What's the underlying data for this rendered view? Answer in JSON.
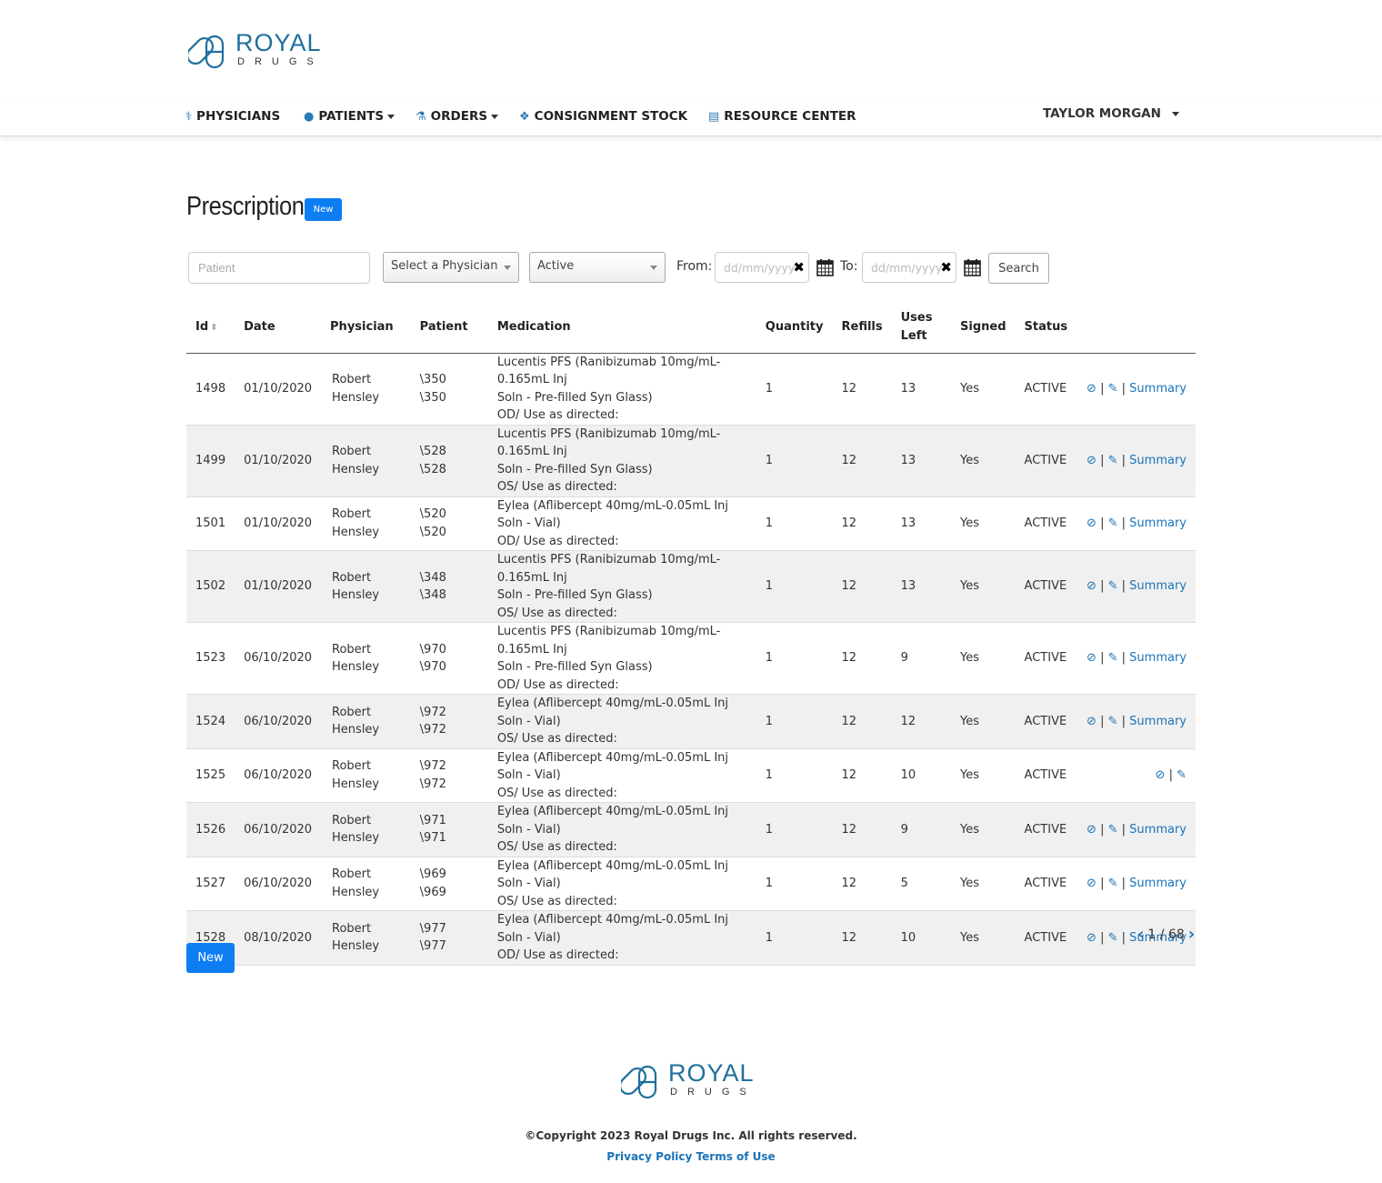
{
  "brand": {
    "name_top": "ROYAL",
    "name_bottom": "DRUGS"
  },
  "nav": {
    "physicians": "PHYSICIANS",
    "patients": "PATIENTS",
    "orders": "ORDERS",
    "consignment": "CONSIGNMENT STOCK",
    "resources": "RESOURCE CENTER",
    "user": "TAYLOR MORGAN"
  },
  "page": {
    "title": "Prescriptions",
    "new_badge": "New",
    "new_button": "New"
  },
  "filters": {
    "patient_placeholder": "Patient",
    "physician_select": "Select a Physician",
    "status_select": "Active",
    "from_label": "From:",
    "to_label": "To:",
    "date_placeholder": "dd/mm/yyyy",
    "search_label": "Search"
  },
  "table": {
    "headers": [
      "Id",
      "Date",
      "Physician",
      "Patient",
      "Medication",
      "Quantity",
      "Refills",
      "Uses Left",
      "Signed",
      "Status"
    ],
    "summary_label": "Summary",
    "rows": [
      {
        "id": "1498",
        "date": "01/10/2020",
        "physician": [
          "Robert",
          "Hensley"
        ],
        "patient": [
          "\\350",
          "\\350"
        ],
        "medication": [
          "Lucentis PFS (Ranibizumab 10mg/mL-0.165mL Inj",
          "Soln - Pre-filled Syn Glass)",
          "OD/ Use as directed:"
        ],
        "quantity": "1",
        "refills": "12",
        "uses_left": "13",
        "signed": "Yes",
        "status": "ACTIVE",
        "summary": true
      },
      {
        "id": "1499",
        "date": "01/10/2020",
        "physician": [
          "Robert",
          "Hensley"
        ],
        "patient": [
          "\\528",
          "\\528"
        ],
        "medication": [
          "Lucentis PFS (Ranibizumab 10mg/mL-0.165mL Inj",
          "Soln - Pre-filled Syn Glass)",
          "OS/ Use as directed:"
        ],
        "quantity": "1",
        "refills": "12",
        "uses_left": "13",
        "signed": "Yes",
        "status": "ACTIVE",
        "summary": true
      },
      {
        "id": "1501",
        "date": "01/10/2020",
        "physician": [
          "Robert",
          "Hensley"
        ],
        "patient": [
          "\\520",
          "\\520"
        ],
        "medication": [
          "Eylea (Aflibercept 40mg/mL-0.05mL Inj Soln - Vial)",
          "OD/ Use as directed:"
        ],
        "quantity": "1",
        "refills": "12",
        "uses_left": "13",
        "signed": "Yes",
        "status": "ACTIVE",
        "summary": true
      },
      {
        "id": "1502",
        "date": "01/10/2020",
        "physician": [
          "Robert",
          "Hensley"
        ],
        "patient": [
          "\\348",
          "\\348"
        ],
        "medication": [
          "Lucentis PFS (Ranibizumab 10mg/mL-0.165mL Inj",
          "Soln - Pre-filled Syn Glass)",
          "OS/ Use as directed:"
        ],
        "quantity": "1",
        "refills": "12",
        "uses_left": "13",
        "signed": "Yes",
        "status": "ACTIVE",
        "summary": true
      },
      {
        "id": "1523",
        "date": "06/10/2020",
        "physician": [
          "Robert",
          "Hensley"
        ],
        "patient": [
          "\\970",
          "\\970"
        ],
        "medication": [
          "Lucentis PFS (Ranibizumab 10mg/mL-0.165mL Inj",
          "Soln - Pre-filled Syn Glass)",
          "OD/ Use as directed:"
        ],
        "quantity": "1",
        "refills": "12",
        "uses_left": "9",
        "signed": "Yes",
        "status": "ACTIVE",
        "summary": true
      },
      {
        "id": "1524",
        "date": "06/10/2020",
        "physician": [
          "Robert",
          "Hensley"
        ],
        "patient": [
          "\\972",
          "\\972"
        ],
        "medication": [
          "Eylea (Aflibercept 40mg/mL-0.05mL Inj Soln - Vial)",
          "OS/ Use as directed:"
        ],
        "quantity": "1",
        "refills": "12",
        "uses_left": "12",
        "signed": "Yes",
        "status": "ACTIVE",
        "summary": true
      },
      {
        "id": "1525",
        "date": "06/10/2020",
        "physician": [
          "Robert",
          "Hensley"
        ],
        "patient": [
          "\\972",
          "\\972"
        ],
        "medication": [
          "Eylea (Aflibercept 40mg/mL-0.05mL Inj Soln - Vial)",
          "OS/ Use as directed:"
        ],
        "quantity": "1",
        "refills": "12",
        "uses_left": "10",
        "signed": "Yes",
        "status": "ACTIVE",
        "summary": false
      },
      {
        "id": "1526",
        "date": "06/10/2020",
        "physician": [
          "Robert",
          "Hensley"
        ],
        "patient": [
          "\\971",
          "\\971"
        ],
        "medication": [
          "Eylea (Aflibercept 40mg/mL-0.05mL Inj Soln - Vial)",
          "OS/ Use as directed:"
        ],
        "quantity": "1",
        "refills": "12",
        "uses_left": "9",
        "signed": "Yes",
        "status": "ACTIVE",
        "summary": true
      },
      {
        "id": "1527",
        "date": "06/10/2020",
        "physician": [
          "Robert",
          "Hensley"
        ],
        "patient": [
          "\\969",
          "\\969"
        ],
        "medication": [
          "Eylea (Aflibercept 40mg/mL-0.05mL Inj Soln - Vial)",
          "OS/ Use as directed:"
        ],
        "quantity": "1",
        "refills": "12",
        "uses_left": "5",
        "signed": "Yes",
        "status": "ACTIVE",
        "summary": true
      },
      {
        "id": "1528",
        "date": "08/10/2020",
        "physician": [
          "Robert",
          "Hensley"
        ],
        "patient": [
          "\\977",
          "\\977"
        ],
        "medication": [
          "Eylea (Aflibercept 40mg/mL-0.05mL Inj Soln - Vial)",
          "OD/ Use as directed:"
        ],
        "quantity": "1",
        "refills": "12",
        "uses_left": "10",
        "signed": "Yes",
        "status": "ACTIVE",
        "summary": true
      }
    ]
  },
  "pagination": {
    "text": "1 / 68"
  },
  "footer": {
    "copyright": "©Copyright 2023 Royal Drugs Inc. All rights reserved.",
    "privacy": "Privacy Policy",
    "terms": "Terms of Use"
  },
  "colors": {
    "accent": "#0d7ef2",
    "link": "#1a73b8",
    "brand": "#1f6f9c"
  },
  "icons": [
    "stethoscope-icon",
    "user-icon",
    "flask-icon",
    "cubes-icon",
    "document-icon",
    "sort-icon",
    "calendar-icon",
    "clear-icon",
    "ban-icon",
    "edit-icon",
    "chevron-left-icon",
    "chevron-right-icon"
  ]
}
